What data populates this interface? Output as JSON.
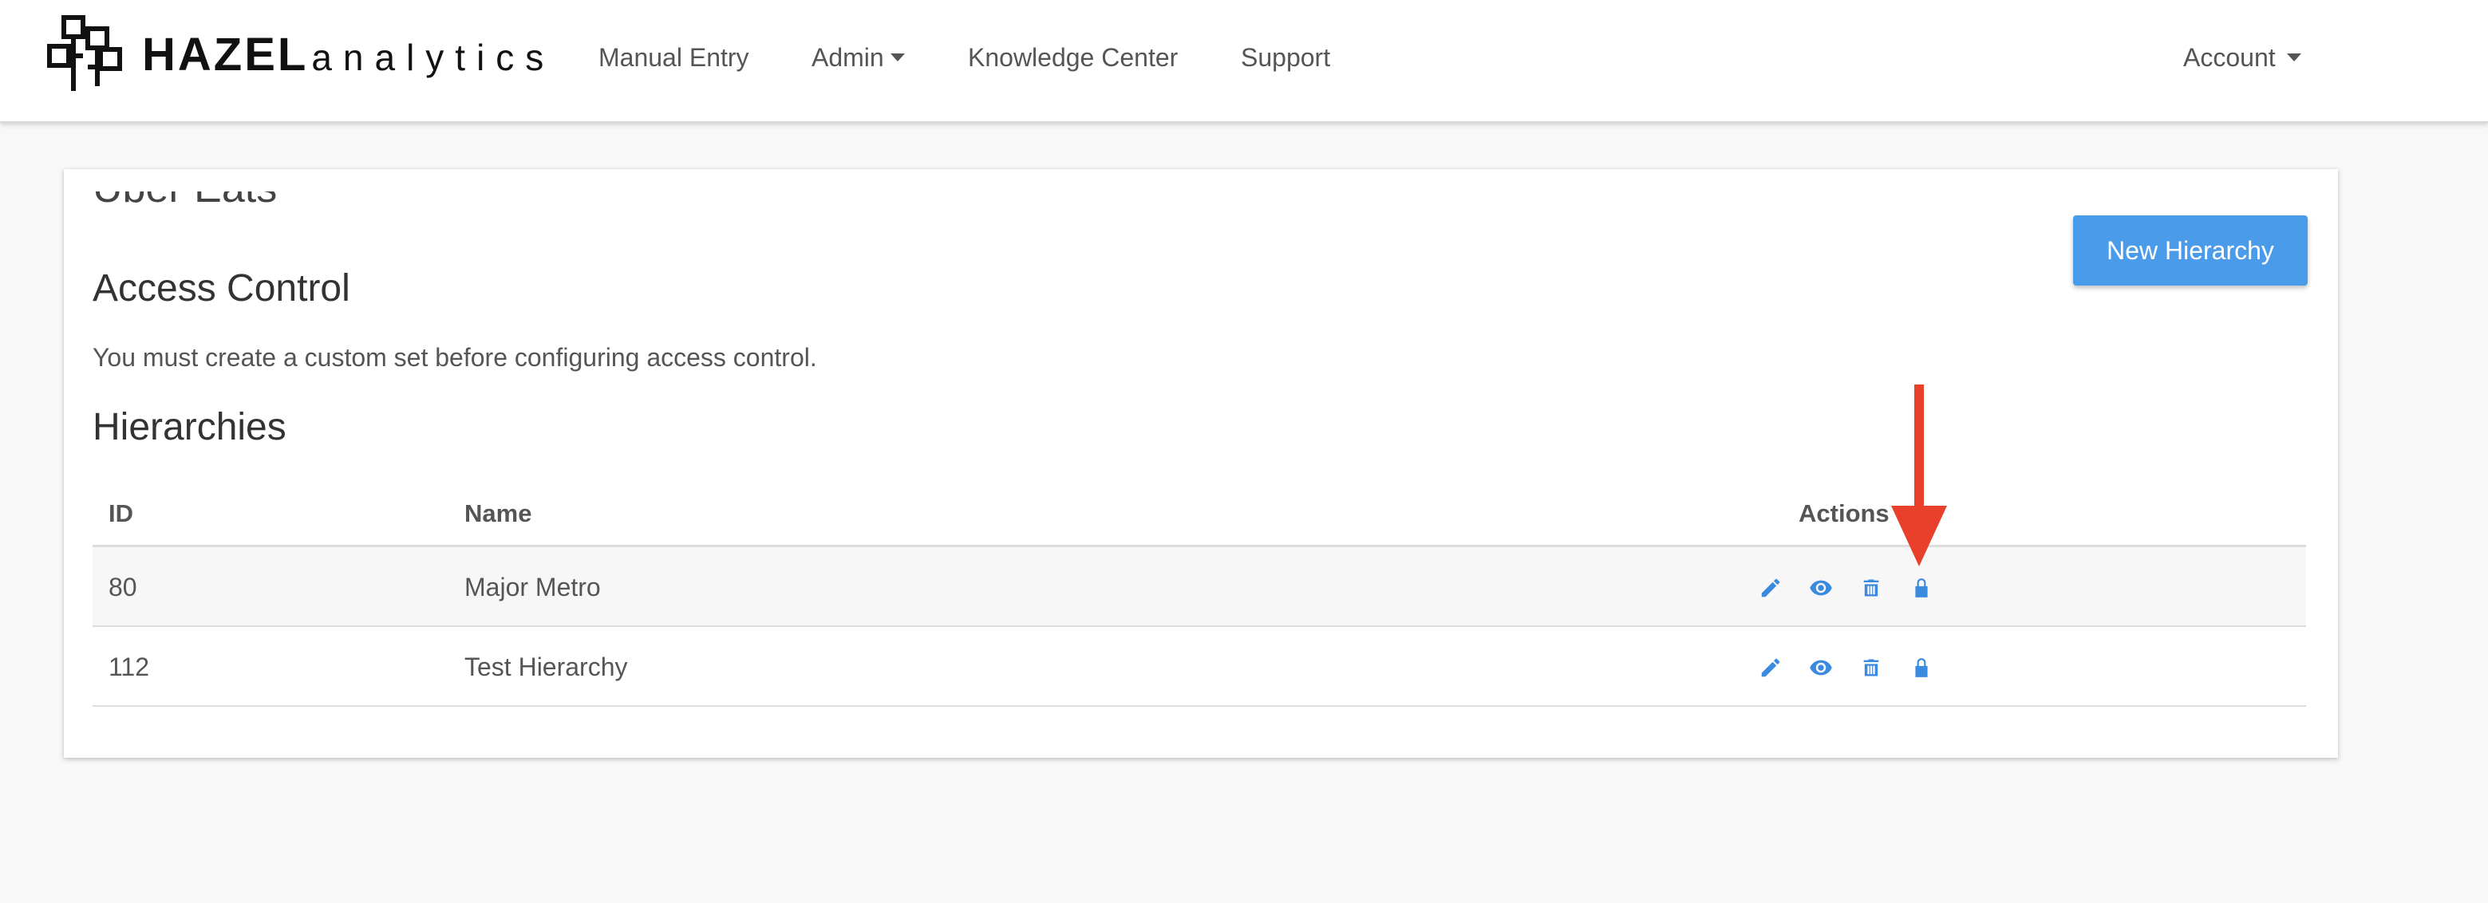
{
  "brand": {
    "word": "HAZEL",
    "sub": "analytics"
  },
  "nav": {
    "items": [
      {
        "label": "Manual Entry"
      },
      {
        "label": "Admin"
      },
      {
        "label": "Knowledge Center"
      },
      {
        "label": "Support"
      }
    ],
    "account_label": "Account"
  },
  "page": {
    "clipped_title": "Uber Eats",
    "access_heading": "Access Control",
    "access_message": "You must create a custom set before configuring access control.",
    "hierarchies_heading": "Hierarchies",
    "new_button": "New Hierarchy"
  },
  "table": {
    "headers": {
      "id": "ID",
      "name": "Name",
      "actions": "Actions"
    },
    "rows": [
      {
        "id": "80",
        "name": "Major Metro"
      },
      {
        "id": "112",
        "name": "Test Hierarchy"
      }
    ],
    "action_icons": [
      "pencil-icon",
      "eye-icon",
      "trash-icon",
      "lock-icon"
    ]
  },
  "colors": {
    "accent": "#4a9bea",
    "icon_blue": "#3a8ae0",
    "annotation_red": "#e8402a"
  }
}
